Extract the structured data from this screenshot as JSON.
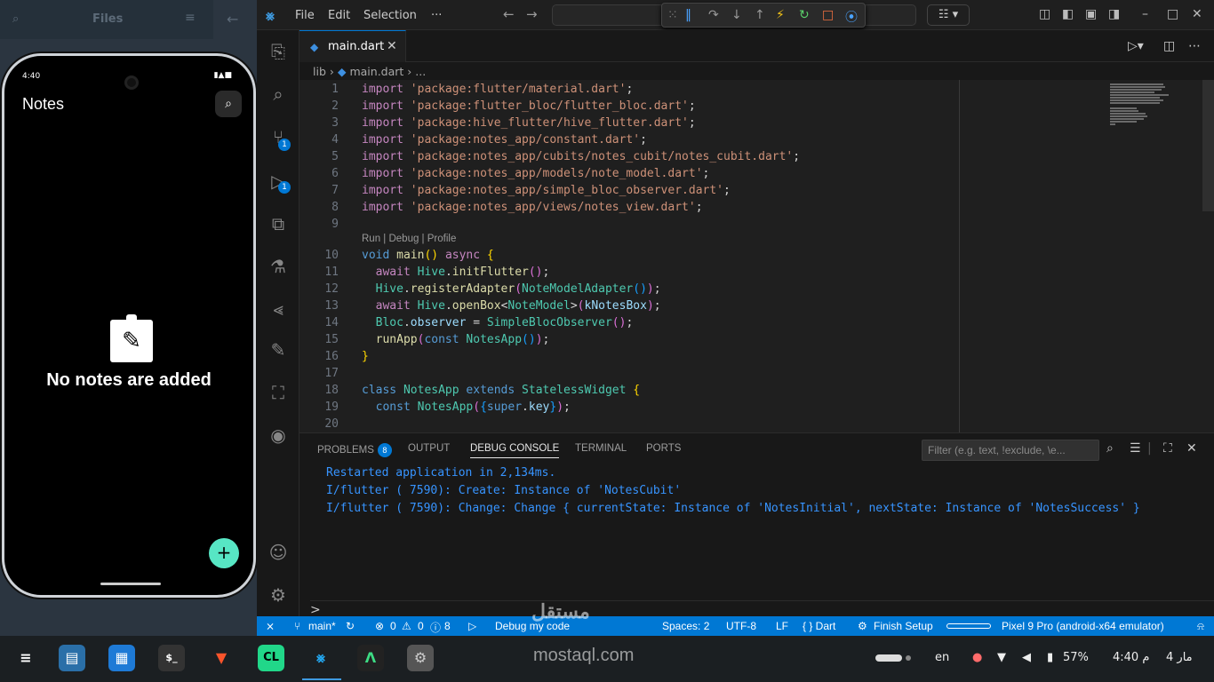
{
  "files_panel": {
    "title": "Files"
  },
  "phone": {
    "time": "4:40",
    "app_title": "Notes",
    "empty_text": "No notes are added",
    "fab": "+"
  },
  "menu": [
    "File",
    "Edit",
    "Selection",
    "···"
  ],
  "tab": {
    "label": "main.dart"
  },
  "breadcrumb": {
    "folder": "lib",
    "file": "main.dart",
    "rest": "..."
  },
  "codelens": "Run | Debug | Profile",
  "line_numbers": [
    "1",
    "2",
    "3",
    "4",
    "5",
    "6",
    "7",
    "8",
    "9",
    "10",
    "11",
    "12",
    "13",
    "14",
    "15",
    "16",
    "17",
    "18",
    "19",
    "20"
  ],
  "code": {
    "l1": "'package:flutter/material.dart'",
    "l2": "'package:flutter_bloc/flutter_bloc.dart'",
    "l3": "'package:hive_flutter/hive_flutter.dart'",
    "l4": "'package:notes_app/constant.dart'",
    "l5": "'package:notes_app/cubits/notes_cubit/notes_cubit.dart'",
    "l6": "'package:notes_app/models/note_model.dart'",
    "l7": "'package:notes_app/simple_bloc_observer.dart'",
    "l8": "'package:notes_app/views/notes_view.dart'"
  },
  "panel": {
    "tabs": [
      "PROBLEMS",
      "OUTPUT",
      "DEBUG CONSOLE",
      "TERMINAL",
      "PORTS"
    ],
    "problems_count": "8",
    "filter_placeholder": "Filter (e.g. text, !exclude, \\e...",
    "lines": [
      "Restarted application in 2,134ms.",
      "I/flutter ( 7590): Create: Instance of 'NotesCubit'",
      "I/flutter ( 7590): Change: Change { currentState: Instance of 'NotesInitial', nextState: Instance of 'NotesSuccess' }"
    ],
    "prompt": ">"
  },
  "status": {
    "branch": "main*",
    "errors": "0",
    "warnings": "0",
    "info": "8",
    "debug": "Debug my code",
    "spaces": "Spaces: 2",
    "encoding": "UTF-8",
    "eol": "LF",
    "lang": "{ } Dart",
    "setup": "Finish Setup",
    "device": "Pixel 9 Pro (android-x64 emulator)"
  },
  "badges": {
    "scm": "1",
    "debug": "1"
  },
  "taskbar": {
    "lang": "en",
    "battery": "57%",
    "time": "4:40 م",
    "date": "مار 4"
  },
  "watermark": {
    "arabic": "مستقل",
    "latin": "mostaql.com"
  }
}
